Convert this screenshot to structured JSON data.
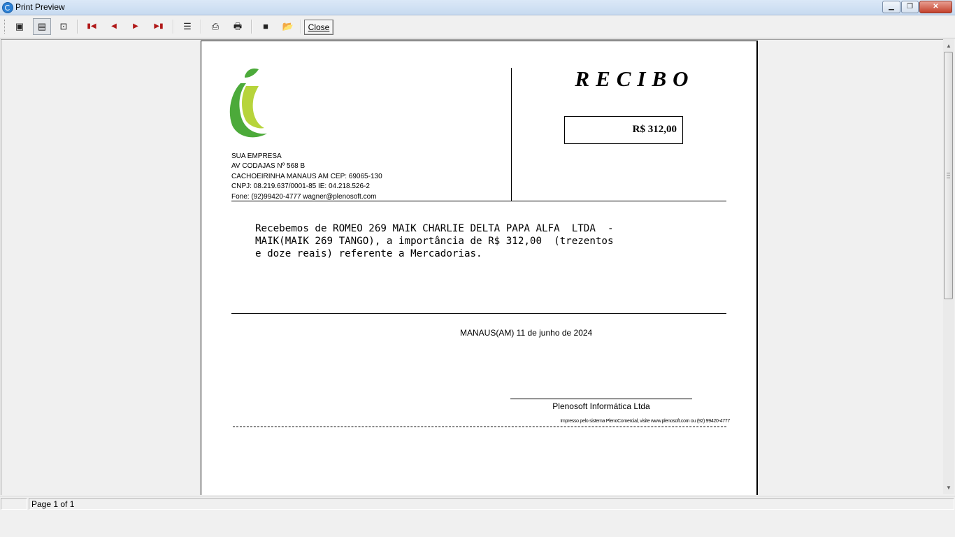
{
  "window": {
    "title": "Print Preview"
  },
  "toolbar": {
    "close_label": "Close",
    "icons": [
      "one-page-icon",
      "page-width-icon",
      "full-page-icon",
      "first-page-icon",
      "prev-page-icon",
      "next-page-icon",
      "last-page-icon",
      "page-setup-icon",
      "printer-setup-icon",
      "print-icon",
      "save-icon",
      "open-icon"
    ]
  },
  "receipt": {
    "company": {
      "line1": "SUA EMPRESA",
      "line2": "AV CODAJAS Nº 568    B",
      "line3": "CACHOEIRINHA MANAUS AM CEP: 69065-130",
      "line4": "CNPJ: 08.219.637/0001-85 IE: 04.218.526-2",
      "line5": "Fone: (92)99420-4777 wagner@plenosoft.com"
    },
    "title": "RECIBO",
    "amount": "R$ 312,00",
    "body": "Recebemos de ROMEO 269 MAIK CHARLIE DELTA PAPA ALFA  LTDA  -\nMAIK(MAIK 269 TANGO), a importância de R$ 312,00  (trezentos\ne doze reais) referente a Mercadorias.",
    "city_date": "MANAUS(AM) 11 de junho de 2024",
    "signature_name": "Plenosoft Informática Ltda",
    "footer_note": "Impresso pelo sistema PlenoComercial, visite www.plenosoft.com ou (92) 99420-4777"
  },
  "status": {
    "page": "Page 1 of 1"
  },
  "colors": {
    "leaf_dark": "#4caa3a",
    "leaf_light": "#b7d43b",
    "titlebar": "#c7daf0"
  }
}
